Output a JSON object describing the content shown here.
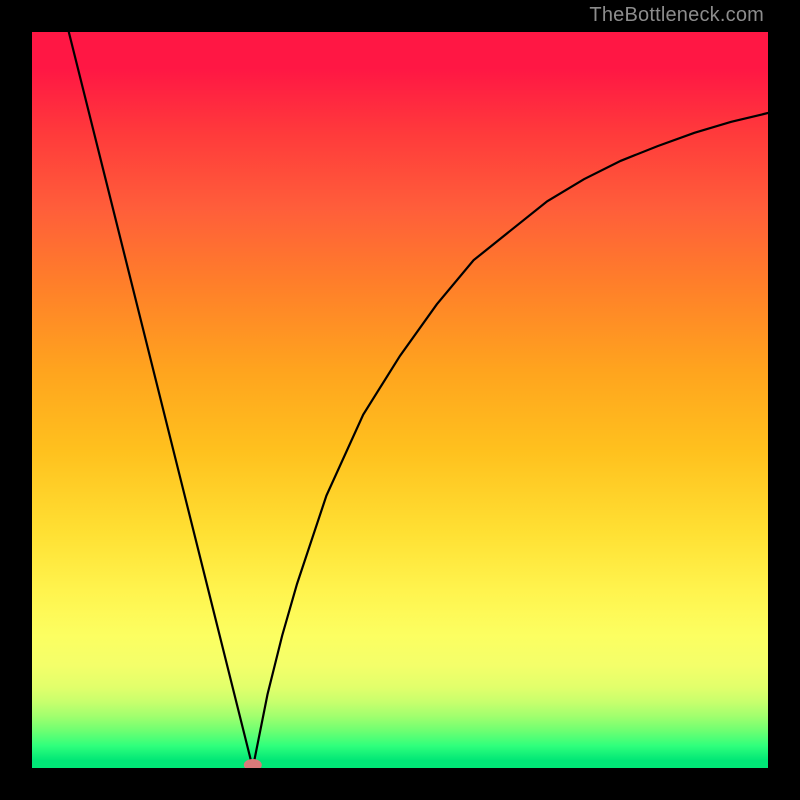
{
  "watermark": "TheBottleneck.com",
  "chart_data": {
    "type": "line",
    "title": "",
    "xlabel": "",
    "ylabel": "",
    "xlim": [
      0,
      100
    ],
    "ylim": [
      0,
      100
    ],
    "grid": false,
    "legend": false,
    "background": "vertical red-yellow-green gradient",
    "series": [
      {
        "name": "left-branch",
        "x": [
          5,
          10,
          15,
          20,
          25,
          30
        ],
        "values": [
          100,
          80,
          60,
          40,
          20,
          0
        ]
      },
      {
        "name": "right-branch",
        "x": [
          30,
          32,
          34,
          36,
          38,
          40,
          45,
          50,
          55,
          60,
          65,
          70,
          75,
          80,
          85,
          90,
          95,
          100
        ],
        "values": [
          0,
          10,
          18,
          25,
          31,
          37,
          48,
          56,
          63,
          69,
          73,
          77,
          80,
          82.5,
          84.5,
          86.3,
          87.8,
          89
        ]
      }
    ],
    "marker": {
      "x": 30,
      "y": 0,
      "shape": "ellipse",
      "color": "#d97a7a"
    }
  }
}
